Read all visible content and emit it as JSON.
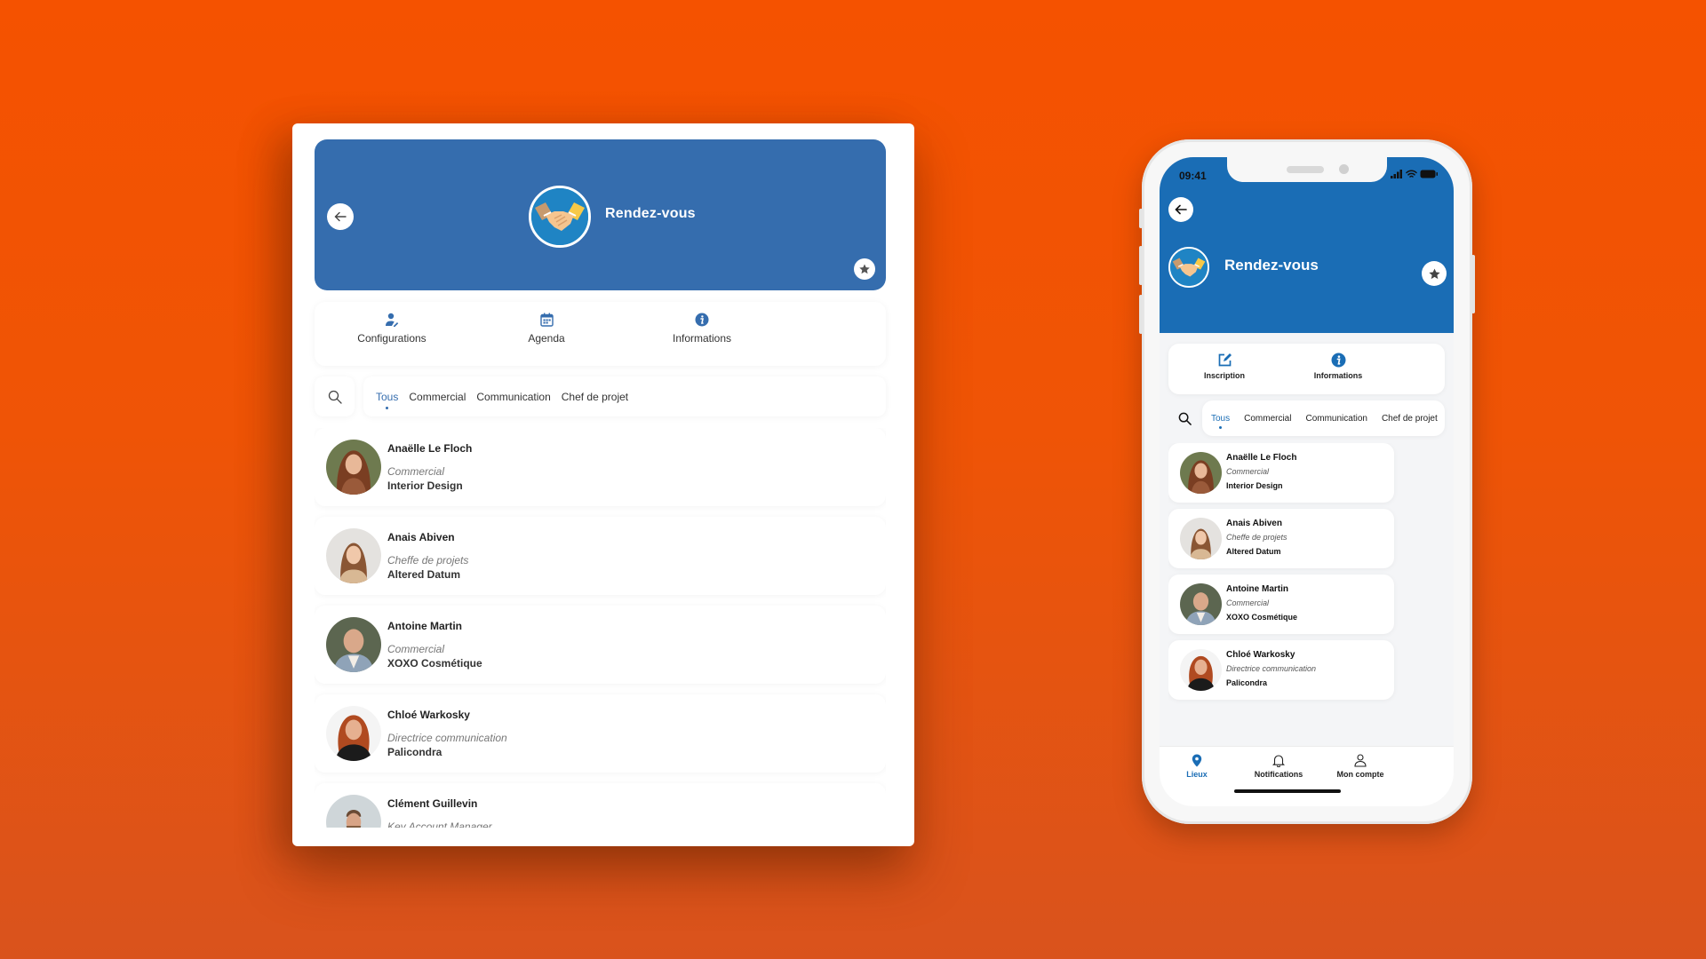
{
  "colors": {
    "background_top": "#f55200",
    "background_bottom": "#d9531d",
    "tablet_header": "#356dae",
    "phone_header": "#1a6db5",
    "accent": "#356dae"
  },
  "tablet": {
    "header": {
      "title": "Rendez-vous",
      "back_icon": "arrow-left-icon",
      "logo_icon": "handshake-icon",
      "favorite_icon": "star-icon"
    },
    "tabs": [
      {
        "label": "Configurations",
        "icon": "user-edit-icon"
      },
      {
        "label": "Agenda",
        "icon": "calendar-icon"
      },
      {
        "label": "Informations",
        "icon": "info-icon"
      }
    ],
    "search_icon": "search-icon",
    "filters": [
      {
        "label": "Tous",
        "active": true
      },
      {
        "label": "Commercial",
        "active": false
      },
      {
        "label": "Communication",
        "active": false
      },
      {
        "label": "Chef de projet",
        "active": false
      }
    ],
    "contacts": [
      {
        "name": "Anaëlle Le Floch",
        "role": "Commercial",
        "company": "Interior Design"
      },
      {
        "name": "Anais Abiven",
        "role": "Cheffe de projets",
        "company": "Altered Datum"
      },
      {
        "name": "Antoine Martin",
        "role": "Commercial",
        "company": "XOXO Cosmétique"
      },
      {
        "name": "Chloé Warkosky",
        "role": "Directrice communication",
        "company": "Palicondra"
      },
      {
        "name": "Clément Guillevin",
        "role": "Key Account Manager",
        "company": ""
      }
    ]
  },
  "phone": {
    "status_bar": {
      "time": "09:41",
      "icons": [
        "signal-icon",
        "wifi-icon",
        "battery-icon"
      ]
    },
    "header": {
      "title": "Rendez-vous",
      "back_icon": "arrow-left-icon",
      "logo_icon": "handshake-icon",
      "favorite_icon": "star-icon"
    },
    "tabs": [
      {
        "label": "Inscription",
        "icon": "edit-icon"
      },
      {
        "label": "Informations",
        "icon": "info-icon"
      }
    ],
    "search_icon": "search-icon",
    "filters": [
      {
        "label": "Tous",
        "active": true
      },
      {
        "label": "Commercial",
        "active": false
      },
      {
        "label": "Communication",
        "active": false
      },
      {
        "label": "Chef de projet",
        "active": false
      }
    ],
    "contacts": [
      {
        "name": "Anaëlle Le Floch",
        "role": "Commercial",
        "company": "Interior Design"
      },
      {
        "name": "Anais Abiven",
        "role": "Cheffe de projets",
        "company": "Altered Datum"
      },
      {
        "name": "Antoine Martin",
        "role": "Commercial",
        "company": "XOXO Cosmétique"
      },
      {
        "name": "Chloé Warkosky",
        "role": "Directrice communication",
        "company": "Palicondra"
      }
    ],
    "bottom_nav": [
      {
        "label": "Lieux",
        "icon": "map-pin-icon",
        "active": true
      },
      {
        "label": "Notifications",
        "icon": "bell-icon",
        "active": false
      },
      {
        "label": "Mon compte",
        "icon": "user-icon",
        "active": false
      }
    ]
  }
}
